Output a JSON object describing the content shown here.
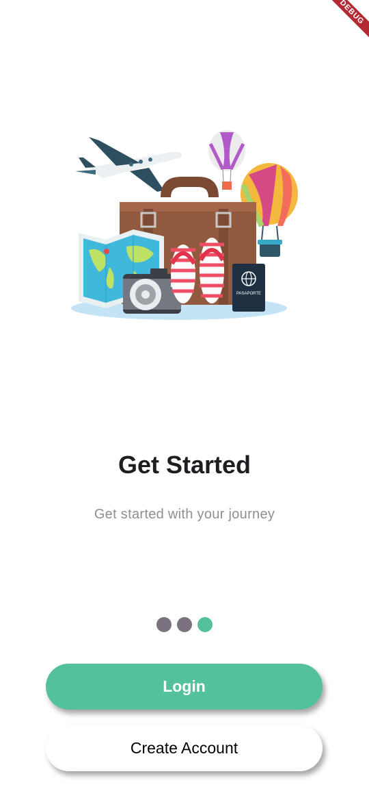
{
  "debug_banner": "DEBUG",
  "hero": {
    "alt": "travel illustration",
    "passport_text": "PASAPORTE"
  },
  "title": "Get Started",
  "subtitle": "Get started with your journey",
  "pager": {
    "total": 3,
    "active_index": 2,
    "inactive_color": "#7a7280",
    "active_color": "#52c19c"
  },
  "buttons": {
    "login_label": "Login",
    "create_account_label": "Create Account",
    "primary_color": "#52c19c"
  }
}
